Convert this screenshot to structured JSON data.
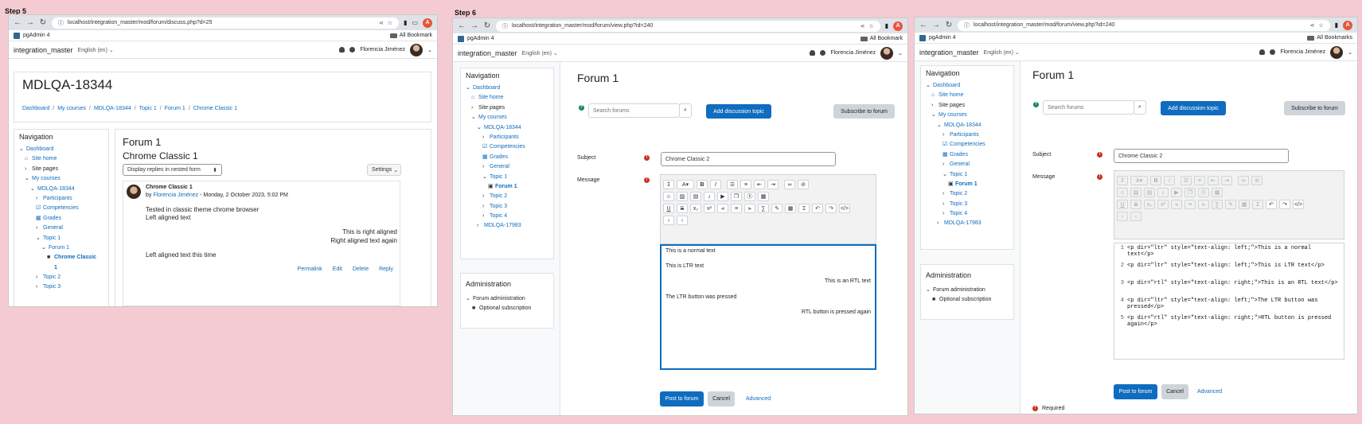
{
  "steps": {
    "step5": "Step 5",
    "step6": "Step 6"
  },
  "browser": {
    "url_discuss": "localhost/integration_master/mod/forum/discuss.php?d=25",
    "url_view": "localhost/integration_master/mod/forum/view.php?id=240",
    "profile_initial": "A",
    "bookmark_pgadmin": "pgAdmin 4",
    "bookmark_all": "All Bookmarks",
    "bookmark_all_short": "All Bookmark"
  },
  "moodle": {
    "site_name": "integration_master",
    "language": "English (en)",
    "user_name": "Florencia Jiménez"
  },
  "step5": {
    "course_title": "MDLQA-18344",
    "breadcrumb": [
      "Dashboard",
      "My courses",
      "MDLQA-18344",
      "Topic 1",
      "Forum 1",
      "Chrome Classic 1"
    ],
    "nav_title": "Navigation",
    "nav_items": [
      {
        "icon": "⌄",
        "label": "Dashboard",
        "level": 0,
        "link": true
      },
      {
        "icon": "⌂",
        "label": "Site home",
        "level": 1,
        "link": true
      },
      {
        "icon": "›",
        "label": "Site pages",
        "level": 1,
        "link": false
      },
      {
        "icon": "⌄",
        "label": "My courses",
        "level": 1,
        "link": true
      },
      {
        "icon": "⌄",
        "label": "MDLQA-18344",
        "level": 2,
        "link": true
      },
      {
        "icon": "›",
        "label": "Participants",
        "level": 3,
        "link": true
      },
      {
        "icon": "☑",
        "label": "Competencies",
        "level": 3,
        "link": true
      },
      {
        "icon": "▦",
        "label": "Grades",
        "level": 3,
        "link": true
      },
      {
        "icon": "›",
        "label": "General",
        "level": 3,
        "link": true
      },
      {
        "icon": "⌄",
        "label": "Topic 1",
        "level": 3,
        "link": true
      },
      {
        "icon": "⌄",
        "label": "Forum 1",
        "level": 4,
        "link": true
      },
      {
        "icon": "■",
        "label": "Chrome Classic",
        "level": 5,
        "link": true,
        "bold": true
      },
      {
        "icon": "",
        "label": "1",
        "level": 5,
        "link": true,
        "bold": true
      },
      {
        "icon": "›",
        "label": "Topic 2",
        "level": 3,
        "link": true
      },
      {
        "icon": "›",
        "label": "Topic 3",
        "level": 3,
        "link": true
      }
    ],
    "forum_title": "Forum 1",
    "discussion_title": "Chrome Classic 1",
    "display_mode": "Display replies in nested form",
    "settings_label": "Settings",
    "post_subject": "Chrome Classic 1",
    "post_by": "by",
    "post_author": "Florencia Jiménez",
    "post_date": "- Monday, 2 October 2023, 5:02 PM",
    "post_lines": [
      {
        "text": "Tested in classic theme chrome browser",
        "align": "left"
      },
      {
        "text": "Left aligned text",
        "align": "left"
      },
      {
        "text": "This is right aligned",
        "align": "right"
      },
      {
        "text": "Right aligned text again",
        "align": "right"
      },
      {
        "text": "Left aligned text this time",
        "align": "left"
      }
    ],
    "actions": [
      "Permalink",
      "Edit",
      "Delete",
      "Reply"
    ]
  },
  "step6": {
    "nav_title": "Navigation",
    "nav_items": [
      {
        "icon": "⌄",
        "label": "Dashboard",
        "level": 0,
        "link": true
      },
      {
        "icon": "⌂",
        "label": "Site home",
        "level": 1,
        "link": true
      },
      {
        "icon": "›",
        "label": "Site pages",
        "level": 1,
        "link": false
      },
      {
        "icon": "⌄",
        "label": "My courses",
        "level": 1,
        "link": true
      },
      {
        "icon": "⌄",
        "label": "MDLQA-18344",
        "level": 2,
        "link": true
      },
      {
        "icon": "›",
        "label": "Participants",
        "level": 3,
        "link": true
      },
      {
        "icon": "☑",
        "label": "Competencies",
        "level": 3,
        "link": true
      },
      {
        "icon": "▦",
        "label": "Grades",
        "level": 3,
        "link": true
      },
      {
        "icon": "›",
        "label": "General",
        "level": 3,
        "link": true
      },
      {
        "icon": "⌄",
        "label": "Topic 1",
        "level": 3,
        "link": true
      },
      {
        "icon": "▣",
        "label": "Forum 1",
        "level": 4,
        "link": true,
        "bold": true
      },
      {
        "icon": "›",
        "label": "Topic 2",
        "level": 3,
        "link": true
      },
      {
        "icon": "›",
        "label": "Topic 3",
        "level": 3,
        "link": true
      },
      {
        "icon": "›",
        "label": "Topic 4",
        "level": 3,
        "link": true
      },
      {
        "icon": "›",
        "label": "MDLQA-17983",
        "level": 2,
        "link": true
      }
    ],
    "admin_title": "Administration",
    "admin_items": [
      {
        "icon": "⌄",
        "label": "Forum administration",
        "level": 0
      },
      {
        "icon": "■",
        "label": "Optional subscription",
        "level": 1
      }
    ],
    "forum_title": "Forum 1",
    "search_placeholder": "Search forums",
    "add_topic": "Add discussion topic",
    "subscribe": "Subscribe to forum",
    "subject_label": "Subject",
    "subject_value": "Chrome Classic 2",
    "message_label": "Message",
    "editor_lines": [
      {
        "text": "This is a normal text",
        "align": "left"
      },
      {
        "text": "This is LTR text",
        "align": "left"
      },
      {
        "text": "This is an RTL text",
        "align": "right"
      },
      {
        "text": "The LTR button was pressed",
        "align": "left"
      },
      {
        "text": "RTL button is pressed again",
        "align": "right"
      }
    ],
    "post_btn": "Post to forum",
    "cancel_btn": "Cancel",
    "advanced_link": "Advanced",
    "required_label": "Required",
    "html_lines": [
      {
        "n": "1",
        "code": "<p dir=\"ltr\" style=\"text-align: left;\">This is a normal text</p>"
      },
      {
        "n": "2",
        "code": "<p dir=\"ltr\" style=\"text-align: left;\">This is LTR text</p>"
      },
      {
        "n": "3",
        "code": "<p dir=\"rtl\" style=\"text-align: right;\">This is an RTL text</p>"
      },
      {
        "n": "4",
        "code": "<p dir=\"ltr\" style=\"text-align: left;\">The LTR button was pressed</p>"
      },
      {
        "n": "5",
        "code": "<p dir=\"rtl\" style=\"text-align: right;\">RTL button is pressed again</p>"
      }
    ]
  }
}
